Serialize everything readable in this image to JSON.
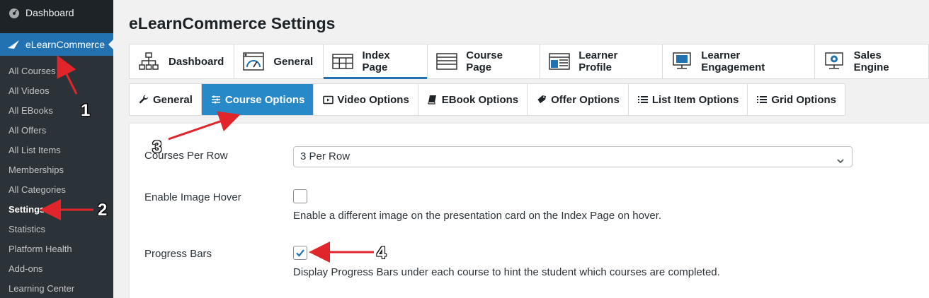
{
  "sidebar": {
    "dashboard_label": "Dashboard",
    "plugin_label": "eLearnCommerce",
    "submenu": [
      "All Courses",
      "All Videos",
      "All EBooks",
      "All Offers",
      "All List Items",
      "Memberships",
      "All Categories",
      "Settings",
      "Statistics",
      "Platform Health",
      "Add-ons",
      "Learning Center"
    ],
    "current_index": 7
  },
  "page": {
    "title": "eLearnCommerce Settings"
  },
  "primary_tabs": [
    {
      "label": "Dashboard",
      "icon": "sitemap-icon"
    },
    {
      "label": "General",
      "icon": "gauge-window-icon"
    },
    {
      "label": "Index Page",
      "icon": "grid-table-icon",
      "active": true
    },
    {
      "label": "Course Page",
      "icon": "list-rows-icon"
    },
    {
      "label": "Learner Profile",
      "icon": "profile-layout-icon"
    },
    {
      "label": "Learner Engagement",
      "icon": "monitor-icon"
    },
    {
      "label": "Sales Engine",
      "icon": "gear-monitor-icon"
    }
  ],
  "secondary_tabs": [
    {
      "label": "General",
      "icon": "wrench-icon"
    },
    {
      "label": "Course Options",
      "icon": "sliders-icon",
      "active": true
    },
    {
      "label": "Video Options",
      "icon": "video-icon"
    },
    {
      "label": "EBook Options",
      "icon": "book-icon"
    },
    {
      "label": "Offer Options",
      "icon": "tag-icon"
    },
    {
      "label": "List Item Options",
      "icon": "list-icon"
    },
    {
      "label": "Grid Options",
      "icon": "list-icon"
    }
  ],
  "settings": {
    "courses_per_row": {
      "label": "Courses Per Row",
      "value": "3 Per Row"
    },
    "image_hover": {
      "label": "Enable Image Hover",
      "checked": false,
      "description": "Enable a different image on the presentation card on the Index Page on hover."
    },
    "progress_bars": {
      "label": "Progress Bars",
      "checked": true,
      "description": "Display Progress Bars under each course to hint the student which courses are completed."
    }
  },
  "annotations": [
    "1",
    "2",
    "3",
    "4"
  ],
  "colors": {
    "sidebar_bg": "#1d2327",
    "submenu_bg": "#2c3338",
    "active_blue": "#2271b1",
    "tab_active_bg": "#2789c7",
    "arrow_red": "#e0262b"
  }
}
